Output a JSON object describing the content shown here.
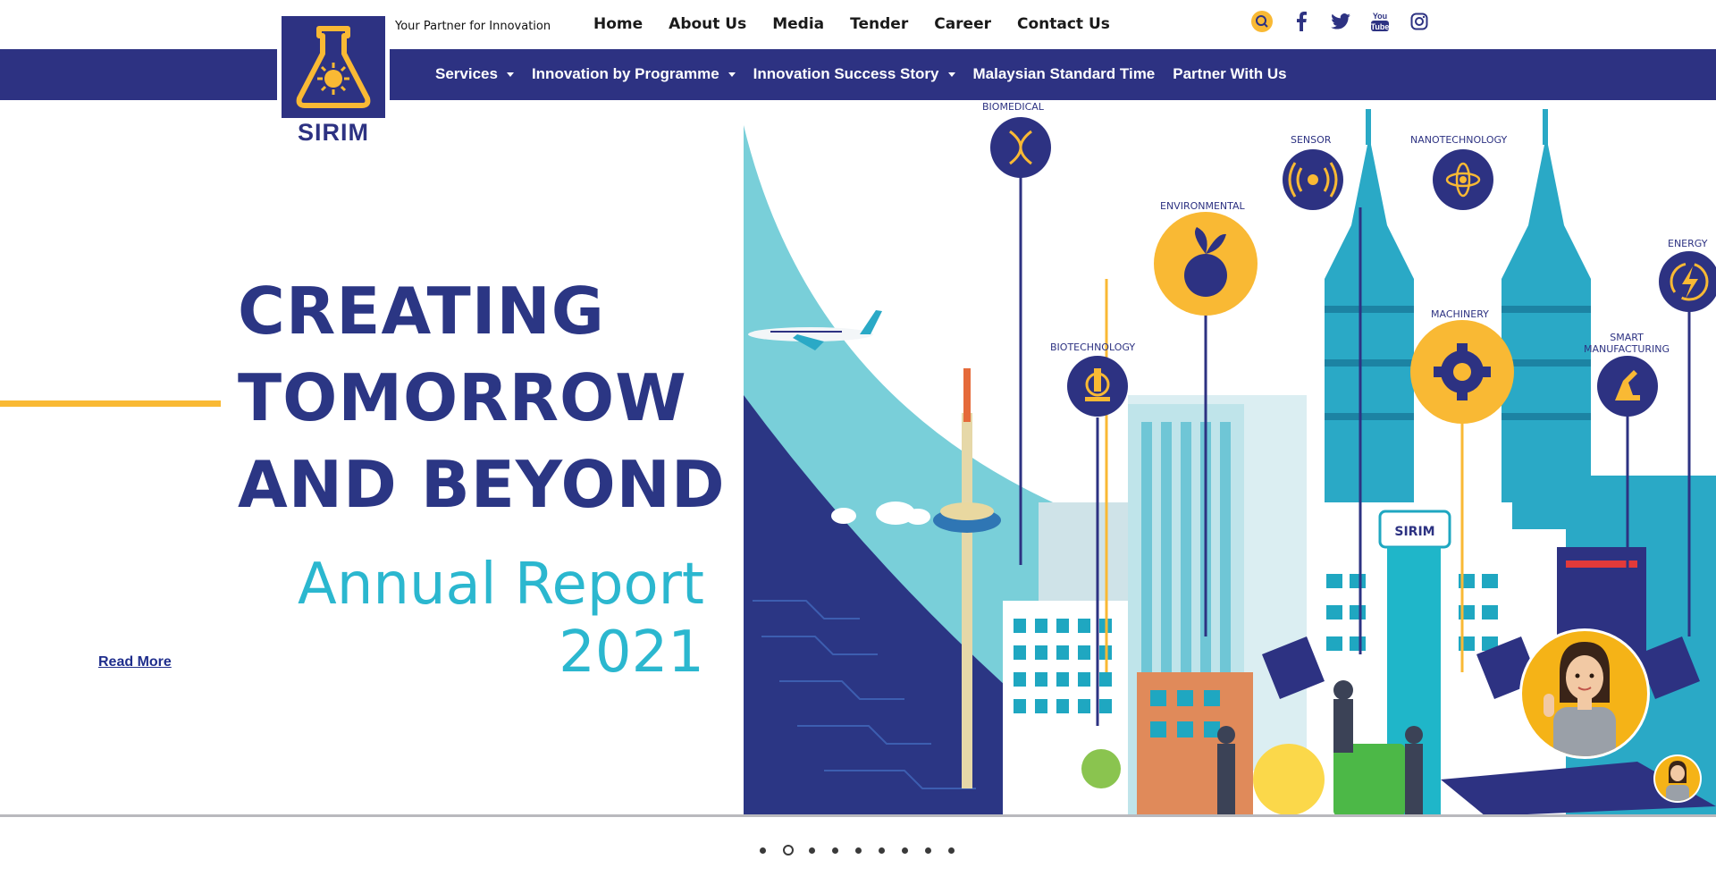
{
  "header": {
    "logo_text": "SIRIM",
    "tagline": "Your Partner for Innovation",
    "top_nav": [
      "Home",
      "About Us",
      "Media",
      "Tender",
      "Career",
      "Contact Us"
    ],
    "socials": [
      "search-icon",
      "facebook-icon",
      "twitter-icon",
      "youtube-icon",
      "instagram-icon"
    ]
  },
  "main_nav": [
    {
      "label": "Services",
      "dropdown": true
    },
    {
      "label": "Innovation by Programme",
      "dropdown": true
    },
    {
      "label": "Innovation Success Story",
      "dropdown": true
    },
    {
      "label": "Malaysian Standard Time",
      "dropdown": false
    },
    {
      "label": "Partner With Us",
      "dropdown": false
    }
  ],
  "hero": {
    "headline": [
      "CREATING",
      "TOMORROW",
      "AND BEYOND"
    ],
    "subtitle_line1": "Annual Report",
    "subtitle_line2": "2021",
    "read_more": "Read More",
    "art_labels": {
      "biomedical": "BIOMEDICAL",
      "sensor": "SENSOR",
      "nanotechnology": "NANOTECHNOLOGY",
      "environmental": "ENVIRONMENTAL",
      "energy": "ENERGY",
      "machinery": "MACHINERY",
      "biotechnology": "BIOTECHNOLOGY",
      "smart_manufacturing_1": "SMART",
      "smart_manufacturing_2": "MANUFACTURING",
      "building_sign": "SIRIM"
    }
  },
  "carousel": {
    "slide_count": 9,
    "active_index": 1
  },
  "colors": {
    "brand_blue": "#2d3282",
    "accent_yellow": "#f9b934",
    "teal": "#2bb7cf"
  }
}
